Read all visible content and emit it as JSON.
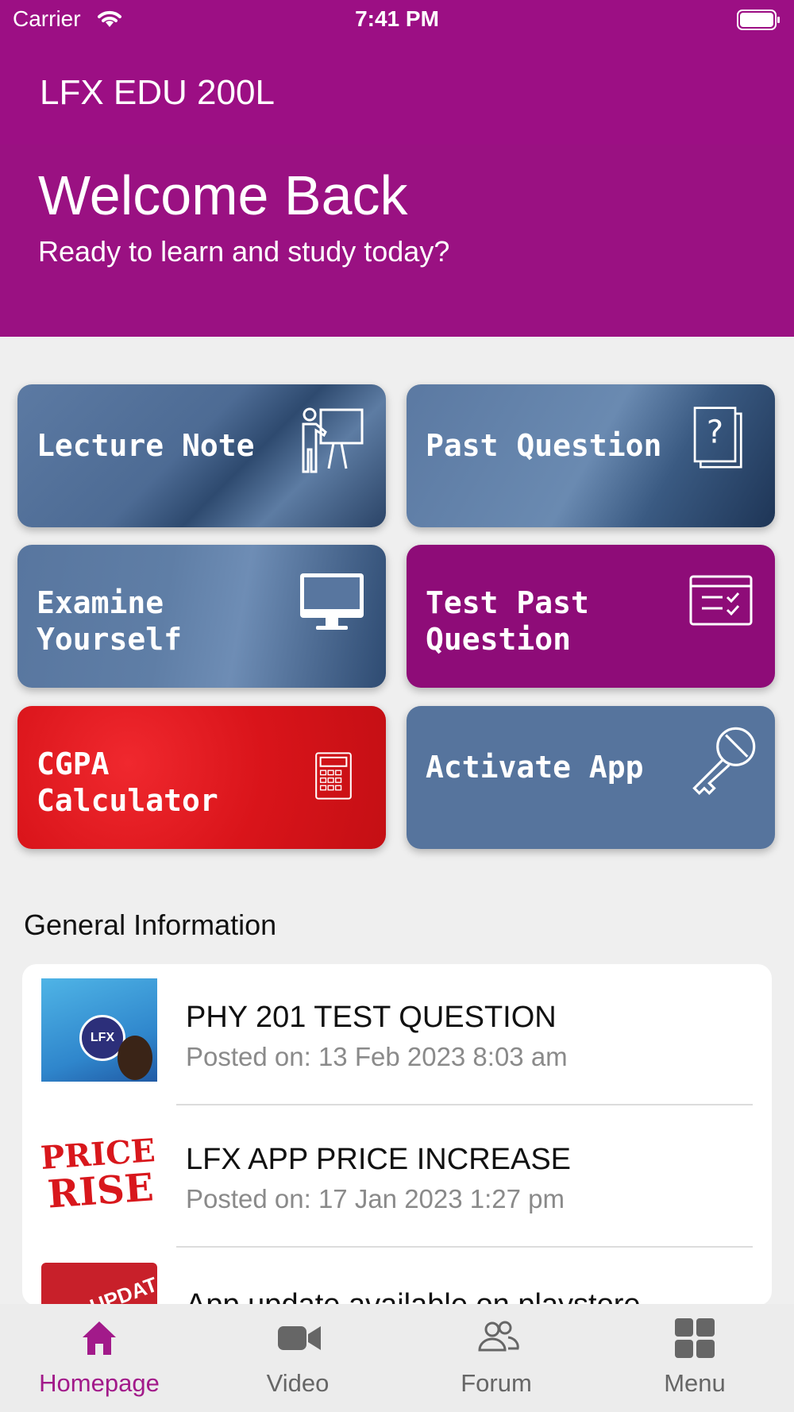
{
  "status_bar": {
    "carrier": "Carrier",
    "time": "7:41 PM"
  },
  "header": {
    "app_title": "LFX EDU 200L",
    "welcome": "Welcome Back",
    "subtitle": "Ready to learn and study today?"
  },
  "cards": [
    {
      "label_line1": "Lecture Note",
      "label_line2": "",
      "icon": "teacher-board-icon"
    },
    {
      "label_line1": "Past Question",
      "label_line2": "",
      "icon": "question-document-icon"
    },
    {
      "label_line1": "Examine",
      "label_line2": "Yourself",
      "icon": "monitor-icon"
    },
    {
      "label_line1": "Test Past",
      "label_line2": "Question",
      "icon": "checklist-window-icon"
    },
    {
      "label_line1": "CGPA",
      "label_line2": "Calculator",
      "icon": "calculator-icon"
    },
    {
      "label_line1": "Activate App",
      "label_line2": "",
      "icon": "key-icon"
    }
  ],
  "general_info": {
    "title": "General Information",
    "items": [
      {
        "title": "PHY 201 TEST QUESTION",
        "date": "Posted on: 13 Feb 2023 8:03 am",
        "thumb_text": "LFX"
      },
      {
        "title": "LFX APP PRICE INCREASE",
        "date": "Posted on: 17 Jan 2023 1:27 pm",
        "thumb_text_1": "PRICE",
        "thumb_text_2": "RISE"
      },
      {
        "title": "App update available on playstore",
        "date": "",
        "thumb_text": "UPDAT"
      }
    ]
  },
  "tabs": [
    {
      "label": "Homepage",
      "icon": "home-icon",
      "active": true
    },
    {
      "label": "Video",
      "icon": "video-camera-icon",
      "active": false
    },
    {
      "label": "Forum",
      "icon": "people-icon",
      "active": false
    },
    {
      "label": "Menu",
      "icon": "grid-menu-icon",
      "active": false
    }
  ],
  "colors": {
    "brand": "#9c0f84",
    "accent_tab": "#a21a8a",
    "card_blue": "#56749d",
    "card_red": "#d9141a"
  }
}
